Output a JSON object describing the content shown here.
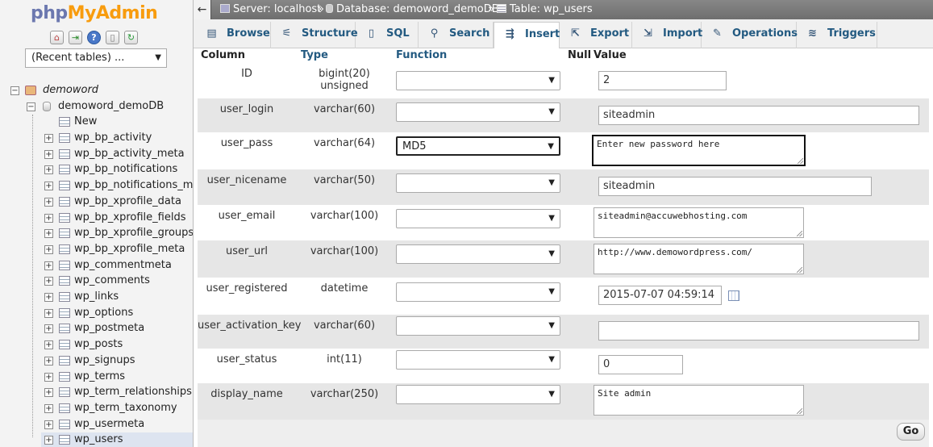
{
  "logo": {
    "php": "php",
    "myadmin": "MyAdmin"
  },
  "nav": {
    "recent_tables": "(Recent tables) ...",
    "server_db": "demoword",
    "database": "demoword_demoDB",
    "new_label": "New",
    "tables": [
      "wp_bp_activity",
      "wp_bp_activity_meta",
      "wp_bp_notifications",
      "wp_bp_notifications_meta",
      "wp_bp_xprofile_data",
      "wp_bp_xprofile_fields",
      "wp_bp_xprofile_groups",
      "wp_bp_xprofile_meta",
      "wp_commentmeta",
      "wp_comments",
      "wp_links",
      "wp_options",
      "wp_postmeta",
      "wp_posts",
      "wp_signups",
      "wp_terms",
      "wp_term_relationships",
      "wp_term_taxonomy",
      "wp_usermeta",
      "wp_users"
    ],
    "selected_table": "wp_users"
  },
  "breadcrumb": {
    "back": "←",
    "server": "Server: localhost",
    "sep": "»",
    "database": "Database: demoword_demoDB",
    "table": "Table: wp_users"
  },
  "tabs": [
    {
      "label": "Browse",
      "icon": "▤"
    },
    {
      "label": "Structure",
      "icon": "⚟"
    },
    {
      "label": "SQL",
      "icon": "▯"
    },
    {
      "label": "Search",
      "icon": "⚲"
    },
    {
      "label": "Insert",
      "icon": "⇶"
    },
    {
      "label": "Export",
      "icon": "⇱"
    },
    {
      "label": "Import",
      "icon": "⇲"
    },
    {
      "label": "Operations",
      "icon": "✎"
    },
    {
      "label": "Triggers",
      "icon": "≋"
    }
  ],
  "active_tab": "Insert",
  "headers": {
    "column": "Column",
    "type": "Type",
    "function": "Function",
    "null": "Null",
    "value": "Value"
  },
  "rows": [
    {
      "column": "ID",
      "type": "bigint(20) unsigned",
      "function": "",
      "value": "2"
    },
    {
      "column": "user_login",
      "type": "varchar(60)",
      "function": "",
      "value": "siteadmin"
    },
    {
      "column": "user_pass",
      "type": "varchar(64)",
      "function": "MD5",
      "value": "Enter new password here"
    },
    {
      "column": "user_nicename",
      "type": "varchar(50)",
      "function": "",
      "value": "siteadmin"
    },
    {
      "column": "user_email",
      "type": "varchar(100)",
      "function": "",
      "value": "siteadmin@accuwebhosting.com"
    },
    {
      "column": "user_url",
      "type": "varchar(100)",
      "function": "",
      "value": "http://www.demowordpress.com/"
    },
    {
      "column": "user_registered",
      "type": "datetime",
      "function": "",
      "value": "2015-07-07 04:59:14"
    },
    {
      "column": "user_activation_key",
      "type": "varchar(60)",
      "function": "",
      "value": ""
    },
    {
      "column": "user_status",
      "type": "int(11)",
      "function": "",
      "value": "0"
    },
    {
      "column": "display_name",
      "type": "varchar(250)",
      "function": "",
      "value": "Site admin"
    }
  ],
  "go_button": "Go",
  "colors": {
    "link": "#235a81",
    "accent_orange": "#f89c0e",
    "logo_blue": "#6c78af"
  }
}
